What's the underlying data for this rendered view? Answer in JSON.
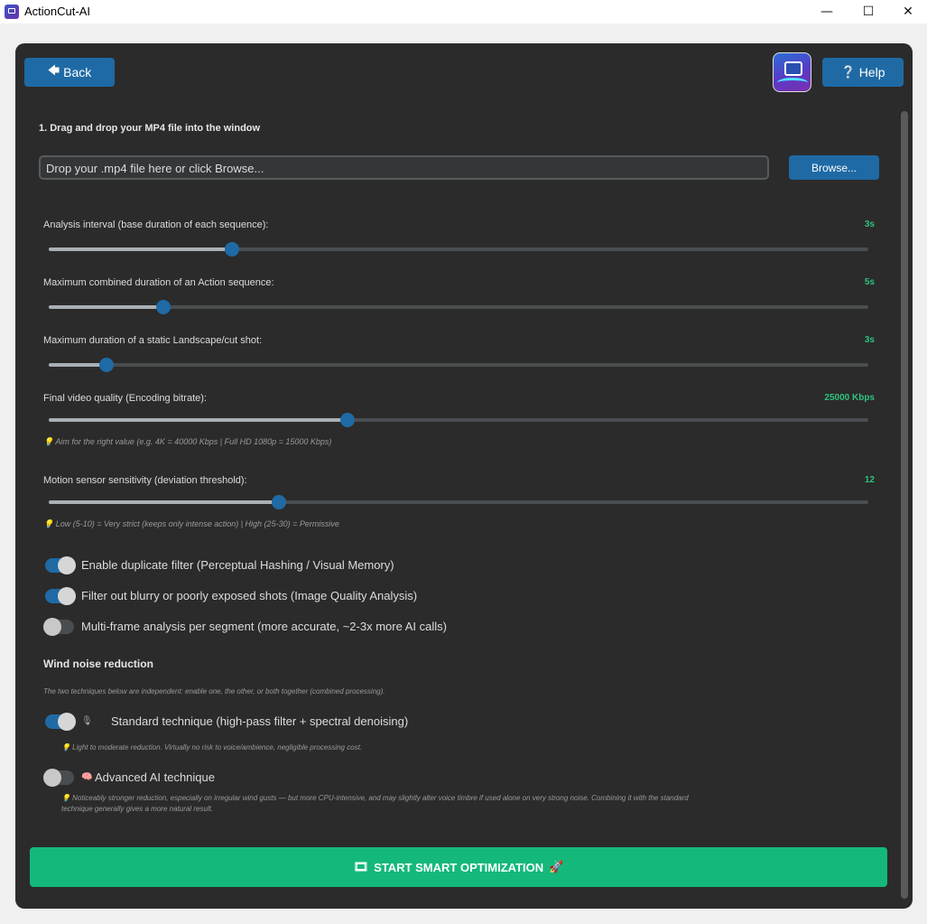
{
  "window": {
    "title": "ActionCut-AI",
    "minimize": "—",
    "maximize": "☐",
    "close": "✕"
  },
  "header": {
    "back_label": "Back",
    "back_icon": "arrow-left-icon",
    "help_label": "Help",
    "help_icon": "question-icon"
  },
  "step1": {
    "title": "1. Drag and drop your MP4 file into the window",
    "file_placeholder": "Drop your .mp4 file here or click Browse...",
    "browse_label": "Browse..."
  },
  "sliders": {
    "interval": {
      "label": "Analysis interval (base duration of each sequence):",
      "value": "3s",
      "fraction": 0.224
    },
    "action": {
      "label": "Maximum combined duration of an Action sequence:",
      "value": "5s",
      "fraction": 0.14
    },
    "static": {
      "label": "Maximum duration of a static Landscape/cut shot:",
      "value": "3s",
      "fraction": 0.07
    },
    "bitrate": {
      "label": "Final video quality (Encoding bitrate):",
      "value": "25000 Kbps",
      "fraction": 0.364,
      "hint": "💡 Aim for the right value (e.g. 4K = 40000 Kbps | Full HD 1080p = 15000 Kbps)"
    },
    "motion": {
      "label": "Motion sensor sensitivity (deviation threshold):",
      "value": "12",
      "fraction": 0.281,
      "hint": "💡 Low (5-10) = Very strict (keeps only intense action) | High (25-30) = Permissive"
    }
  },
  "toggles": {
    "duplicate": {
      "label": "Enable duplicate filter (Perceptual Hashing / Visual Memory)",
      "on": true
    },
    "blurry": {
      "label": "Filter out blurry or poorly exposed shots (Image Quality Analysis)",
      "on": true
    },
    "multiframe": {
      "label": "Multi-frame analysis per segment (more accurate, ~2-3x more AI calls)",
      "on": false
    }
  },
  "wind": {
    "title": "Wind noise reduction",
    "subtitle": "The two techniques below are independent: enable one, the other, or both together (combined processing).",
    "standard": {
      "label": "Standard technique (high-pass filter + spectral denoising)",
      "on": true,
      "hint": "💡 Light to moderate reduction. Virtually no risk to voice/ambience, negligible processing cost."
    },
    "advanced": {
      "label": "Advanced AI technique",
      "on": false,
      "hint_line1": "💡 Noticeably stronger reduction, especially on irregular wind gusts — but more CPU-intensive, and may slightly alter voice timbre if used alone on very strong noise. Combining it with the standard",
      "hint_line2": "technique generally gives a more natural result."
    }
  },
  "start": {
    "label": "START SMART OPTIMIZATION",
    "icon_left": "film-icon",
    "icon_right": "rocket-icon"
  },
  "colors": {
    "accent": "#1f6aa5",
    "success": "#14b87b",
    "value_green": "#2ec27e",
    "panel": "#2b2b2b"
  }
}
